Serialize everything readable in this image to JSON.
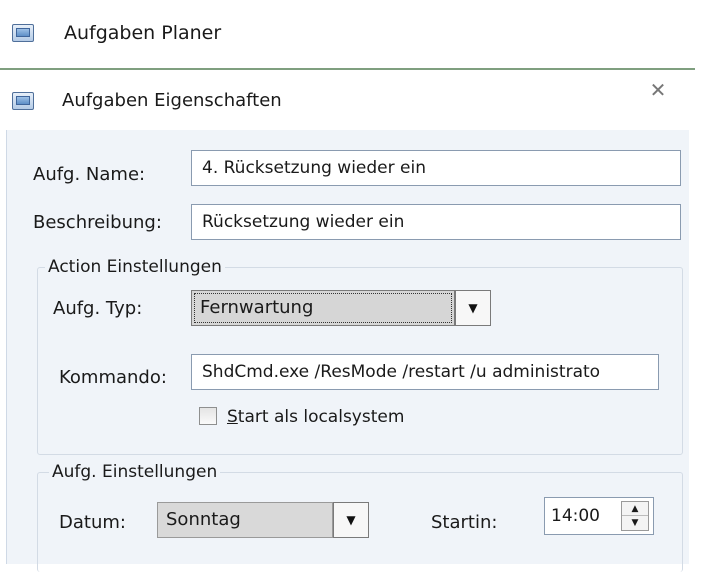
{
  "app": {
    "title": "Aufgaben Planer"
  },
  "dialog": {
    "title": "Aufgaben Eigenschaften",
    "close_glyph": "✕"
  },
  "fields": {
    "name_label": "Aufg. Name:",
    "name_value": "4. Rücksetzung wieder ein",
    "description_label": "Beschreibung:",
    "description_value": "Rücksetzung wieder ein"
  },
  "action_group": {
    "title": "Action Einstellungen",
    "type_label": "Aufg. Typ:",
    "type_value": "Fernwartung",
    "command_label": "Kommando:",
    "command_value": "ShdCmd.exe /ResMode /restart /u administrato",
    "start_localsystem_prefix": "S",
    "start_localsystem_rest": "tart als localsystem",
    "start_localsystem_checked": false
  },
  "schedule_group": {
    "title": "Aufg. Einstellungen",
    "date_label": "Datum:",
    "date_value": "Sonntag",
    "start_label": "Startin:",
    "start_value": "14:00"
  },
  "glyphs": {
    "dropdown": "▼",
    "spin_up": "▲",
    "spin_down": "▼"
  },
  "colors": {
    "dialog_bg": "#f0f4f9",
    "combo_selected_bg": "#d6d6d6",
    "combo_disabled_bg": "#d9d9d9",
    "title_separator": "#7f9f7f"
  }
}
